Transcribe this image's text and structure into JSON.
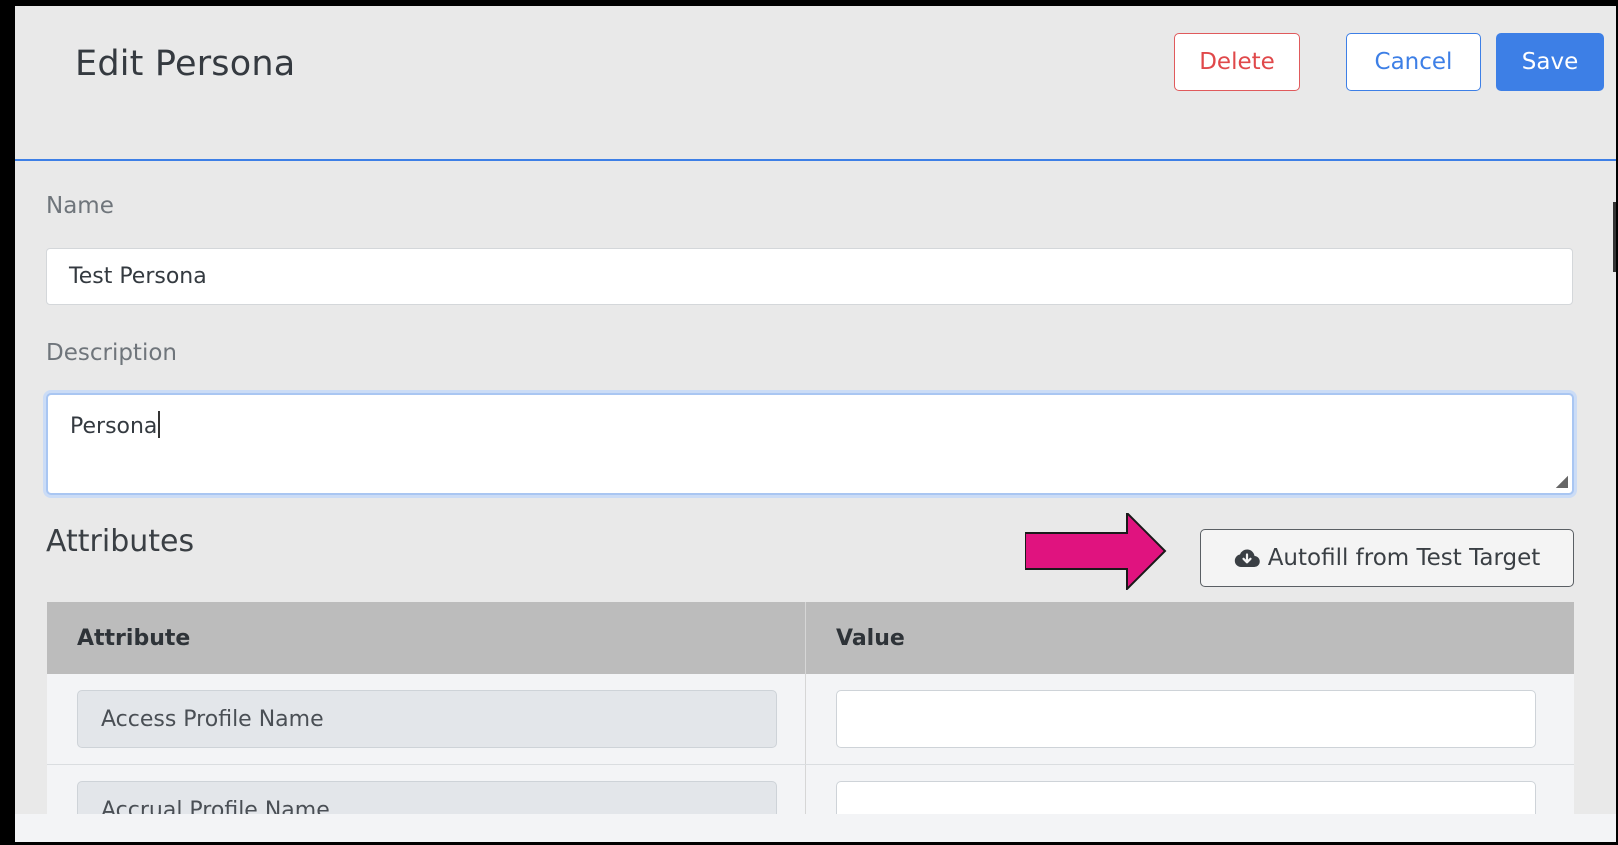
{
  "header": {
    "title": "Edit Persona",
    "delete_label": "Delete",
    "cancel_label": "Cancel",
    "save_label": "Save"
  },
  "form": {
    "name_label": "Name",
    "name_value": "Test Persona",
    "description_label": "Description",
    "description_value": "Persona"
  },
  "attributes": {
    "title": "Attributes",
    "autofill_label": "Autofill from Test Target",
    "autofill_icon": "cloud-download-icon",
    "columns": [
      "Attribute",
      "Value"
    ],
    "rows": [
      {
        "attribute": "Access Profile Name",
        "value": ""
      },
      {
        "attribute": "Accrual Profile Name",
        "value": ""
      }
    ]
  },
  "colors": {
    "primary": "#3d7fe6",
    "danger": "#e0484a",
    "annotation_arrow": "#e0137f"
  }
}
